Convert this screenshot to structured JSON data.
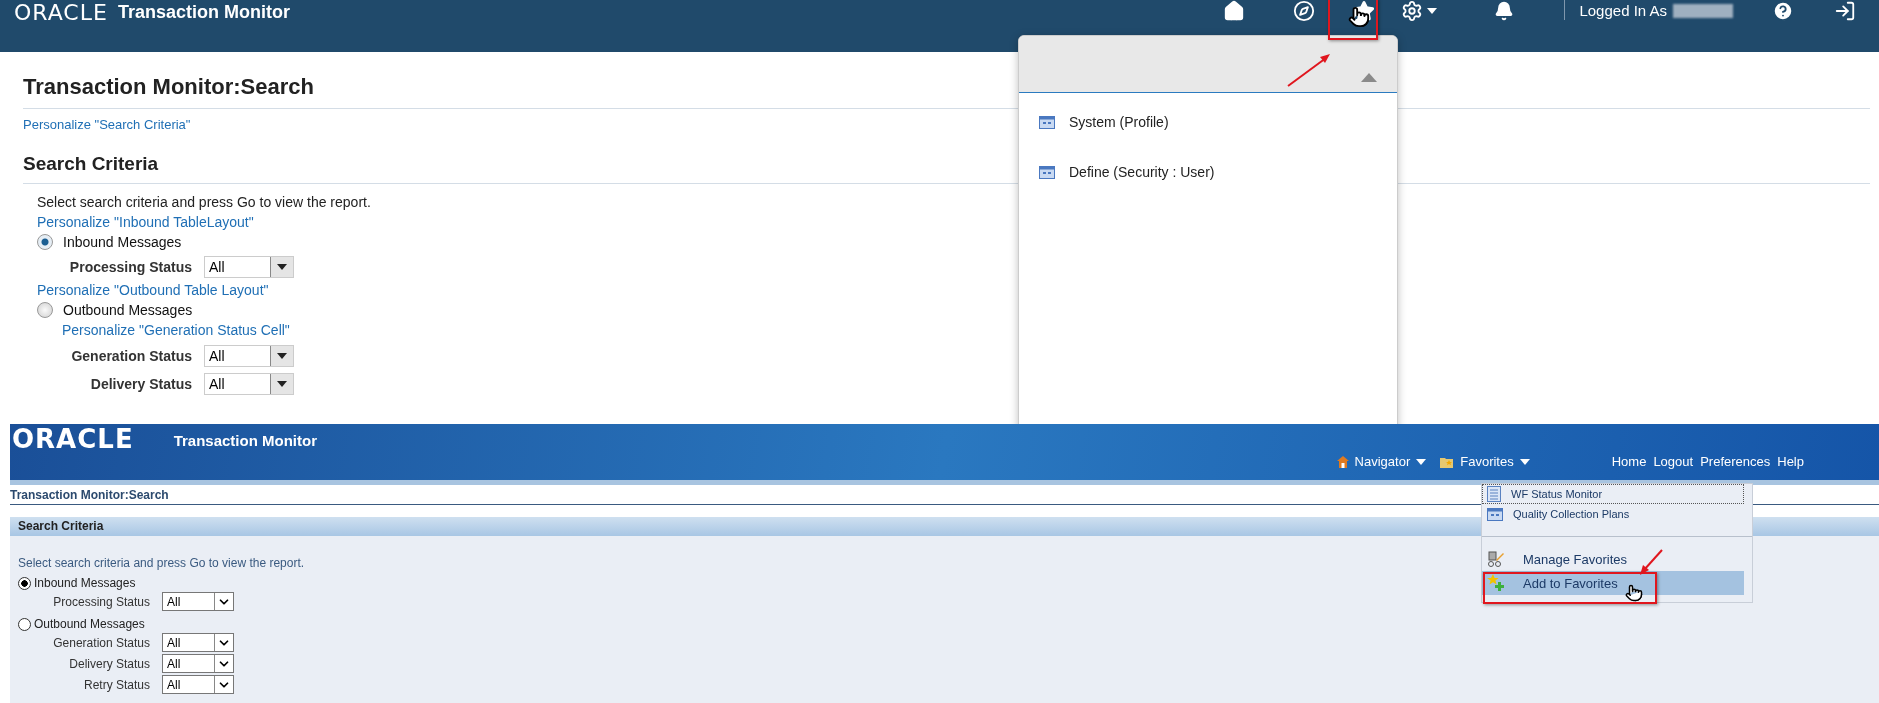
{
  "upper_screenshot": {
    "header": {
      "logo": "ORACLE",
      "app_title": "Transaction Monitor",
      "logged_in_label": "Logged In As"
    },
    "page_title": "Transaction Monitor:Search",
    "personalize_link": "Personalize \"Search Criteria\"",
    "section_title": "Search Criteria",
    "instructions": "Select search criteria and press Go to view the report.",
    "options": [
      {
        "personalize_link": "Personalize \"Inbound TableLayout\"",
        "label": "Inbound Messages",
        "selected": true,
        "fields": [
          {
            "label": "Processing Status",
            "value": "All"
          }
        ]
      },
      {
        "personalize_link": "Personalize \"Outbound Table Layout\"",
        "label": "Outbound Messages",
        "selected": false,
        "fields_link": "Personalize \"Generation Status Cell\"",
        "fields": [
          {
            "label": "Generation Status",
            "value": "All"
          },
          {
            "label": "Delivery Status",
            "value": "All"
          }
        ]
      }
    ],
    "favorites_menu": {
      "items": [
        {
          "label": "System (Profile)"
        },
        {
          "label": "Define (Security : User)"
        }
      ]
    }
  },
  "lower_screenshot": {
    "header": {
      "logo": "ORACLE",
      "app_title": "Transaction Monitor",
      "menus": [
        {
          "label": "Navigator",
          "kind": "navigator"
        },
        {
          "label": "Favorites",
          "kind": "favorites"
        }
      ],
      "links": [
        "Home",
        "Logout",
        "Preferences",
        "Help"
      ]
    },
    "page_title": "Transaction Monitor:Search",
    "section_title": "Search Criteria",
    "instructions": "Select search criteria and press Go to view the report.",
    "options": [
      {
        "label": "Inbound Messages",
        "selected": true,
        "fields": [
          {
            "label": "Processing Status",
            "value": "All"
          }
        ]
      },
      {
        "label": "Outbound Messages",
        "selected": false,
        "fields": [
          {
            "label": "Generation Status",
            "value": "All"
          },
          {
            "label": "Delivery Status",
            "value": "All"
          },
          {
            "label": "Retry Status",
            "value": "All"
          }
        ]
      }
    ],
    "favorites_menu": {
      "items": [
        {
          "label": "WF Status Monitor",
          "kind": "page",
          "focused": true,
          "selected": false
        },
        {
          "label": "Quality Collection Plans",
          "kind": "form",
          "focused": false,
          "selected": false
        },
        {
          "label": "Manage Favorites",
          "kind": "manage",
          "focused": false,
          "selected": false
        },
        {
          "label": "Add to Favorites",
          "kind": "add",
          "focused": false,
          "selected": true
        }
      ]
    }
  }
}
